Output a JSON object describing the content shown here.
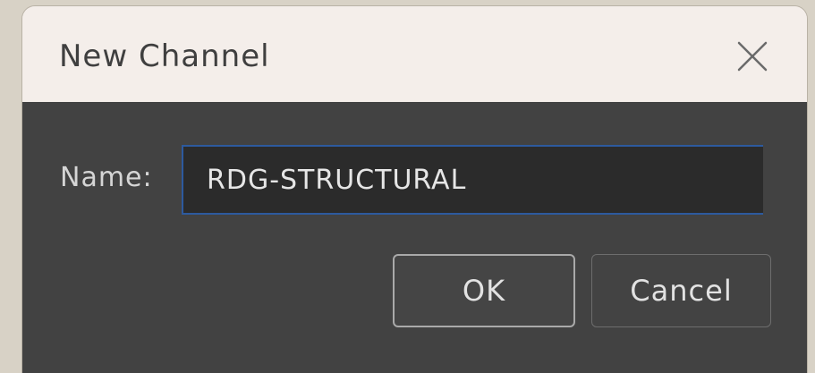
{
  "dialog": {
    "title": "New Channel",
    "close_icon": "close-icon",
    "name_label": "Name:",
    "name_value": "RDG-STRUCTURAL",
    "ok_label": "OK",
    "cancel_label": "Cancel"
  },
  "colors": {
    "titlebar_bg": "#f4eeea",
    "body_bg": "#424242",
    "input_bg": "#2b2b2b",
    "input_focus_border": "#2d5a9e",
    "desktop_bg": "#d8d2c6"
  }
}
